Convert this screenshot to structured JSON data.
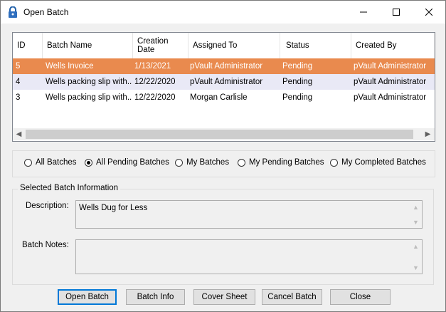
{
  "window": {
    "title": "Open Batch"
  },
  "grid": {
    "headers": {
      "id": "ID",
      "batch_name": "Batch Name",
      "creation_date_1": "Creation",
      "creation_date_2": "Date",
      "assigned_to": "Assigned To",
      "status": "Status",
      "created_by": "Created By"
    },
    "rows": [
      {
        "id": "5",
        "batch_name": "Wells Invoice",
        "creation_date": "1/13/2021",
        "assigned_to": "pVault Administrator",
        "status": "Pending",
        "created_by": "pVault Administrator"
      },
      {
        "id": "4",
        "batch_name": "Wells packing slip with...",
        "creation_date": "12/22/2020",
        "assigned_to": "pVault Administrator",
        "status": "Pending",
        "created_by": "pVault Administrator"
      },
      {
        "id": "3",
        "batch_name": "Wells packing slip with...",
        "creation_date": "12/22/2020",
        "assigned_to": "Morgan Carlisle",
        "status": "Pending",
        "created_by": "pVault Administrator"
      }
    ],
    "selected_row": "5"
  },
  "filters": {
    "options": [
      "All Batches",
      "All Pending Batches",
      "My Batches",
      "My Pending Batches",
      "My Completed Batches"
    ],
    "selected": "All Pending Batches"
  },
  "info": {
    "group_title": "Selected Batch Information",
    "description_label": "Description:",
    "description_value": "Wells Dug for Less",
    "notes_label": "Batch Notes:",
    "notes_value": ""
  },
  "buttons": {
    "open": "Open Batch",
    "info": "Batch Info",
    "cover": "Cover Sheet",
    "cancel": "Cancel Batch",
    "close": "Close"
  },
  "colors": {
    "selected_row": "#e98a4e",
    "alt_row": "#e9e9f6",
    "default_button_border": "#0078d7"
  }
}
